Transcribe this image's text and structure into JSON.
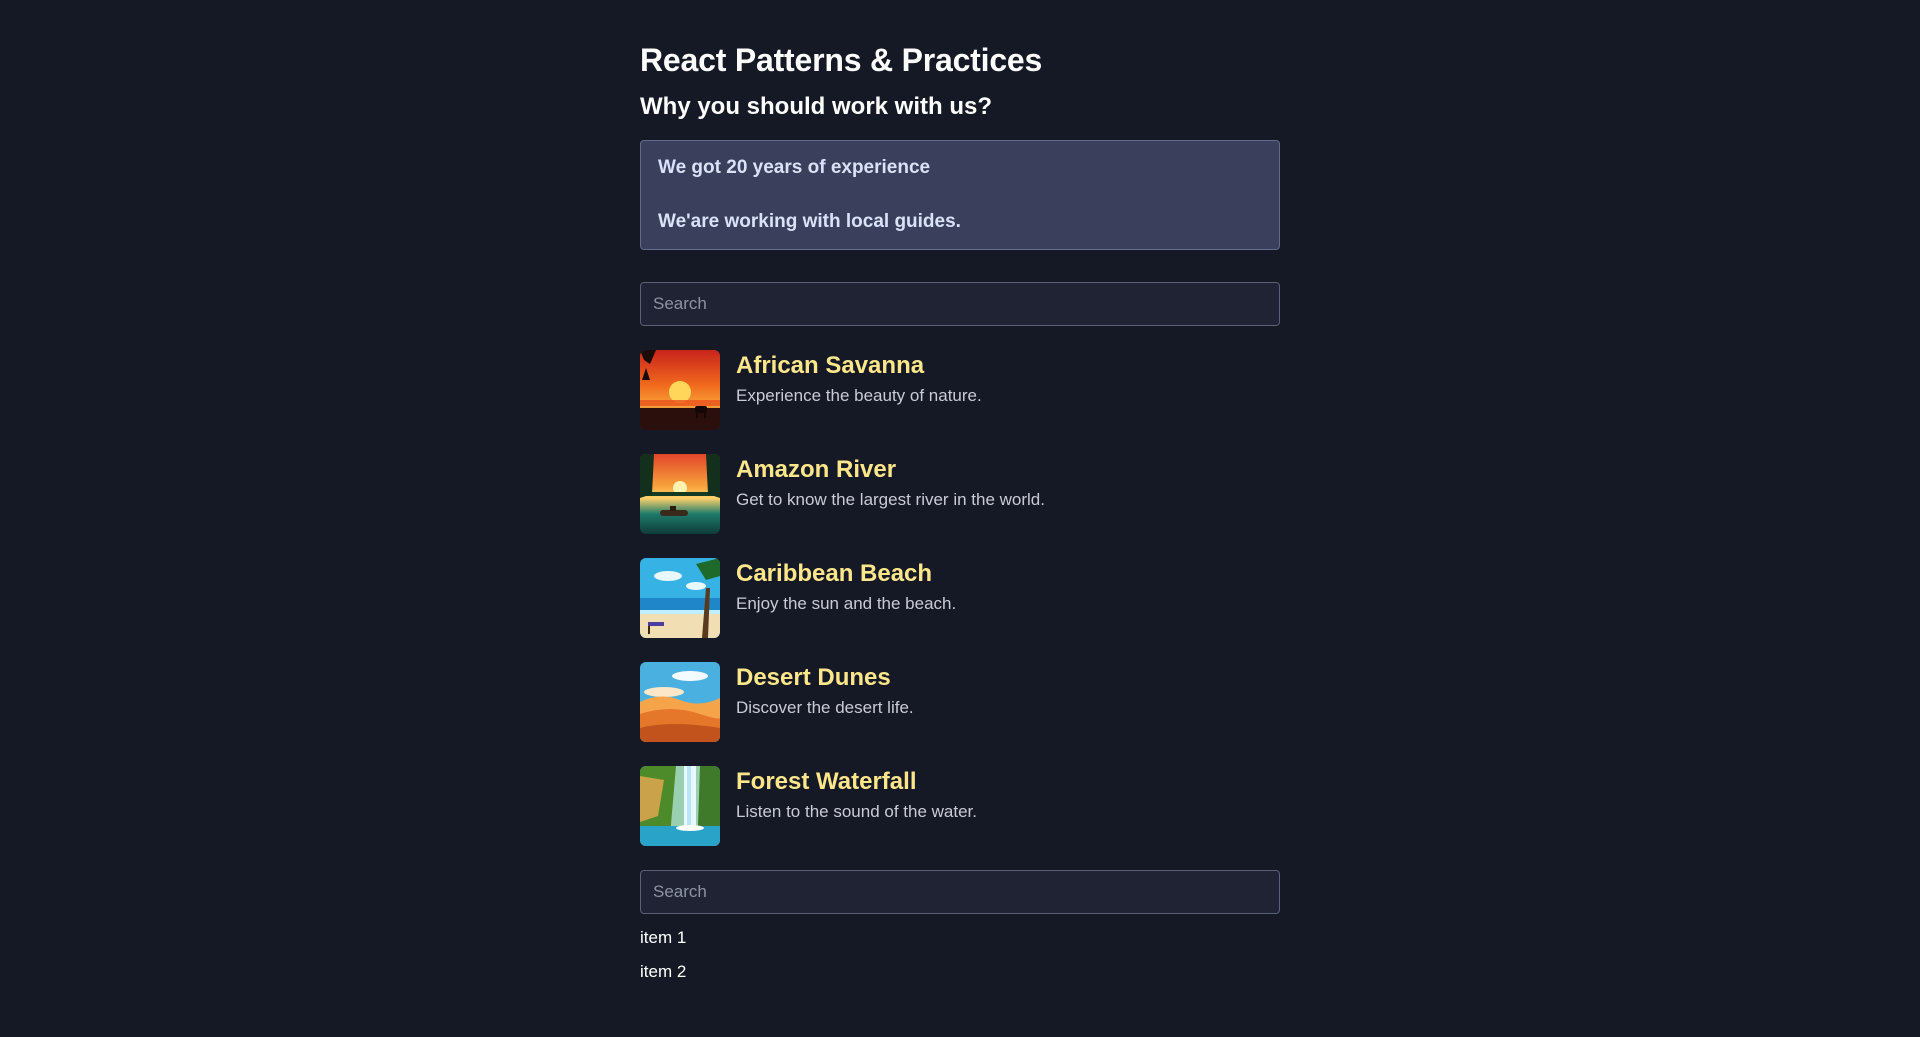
{
  "page": {
    "title": "React Patterns & Practices",
    "subtitle": "Why you should work with us?"
  },
  "reasons": [
    "We got 20 years of experience",
    "We'are working with local guides."
  ],
  "search_top": {
    "placeholder": "Search",
    "value": ""
  },
  "destinations": [
    {
      "name": "African Savanna",
      "description": "Experience the beauty of nature.",
      "image": "savanna-sunset-illustration"
    },
    {
      "name": "Amazon River",
      "description": "Get to know the largest river in the world.",
      "image": "river-sunset-illustration"
    },
    {
      "name": "Caribbean Beach",
      "description": "Enjoy the sun and the beach.",
      "image": "beach-illustration"
    },
    {
      "name": "Desert Dunes",
      "description": "Discover the desert life.",
      "image": "desert-illustration"
    },
    {
      "name": "Forest Waterfall",
      "description": "Listen to the sound of the water.",
      "image": "waterfall-illustration"
    }
  ],
  "search_bottom": {
    "placeholder": "Search",
    "value": ""
  },
  "items": [
    "item 1",
    "item 2"
  ],
  "colors": {
    "background": "#151925",
    "accent_title": "#fde68a",
    "panel": "#3a3f5c"
  }
}
